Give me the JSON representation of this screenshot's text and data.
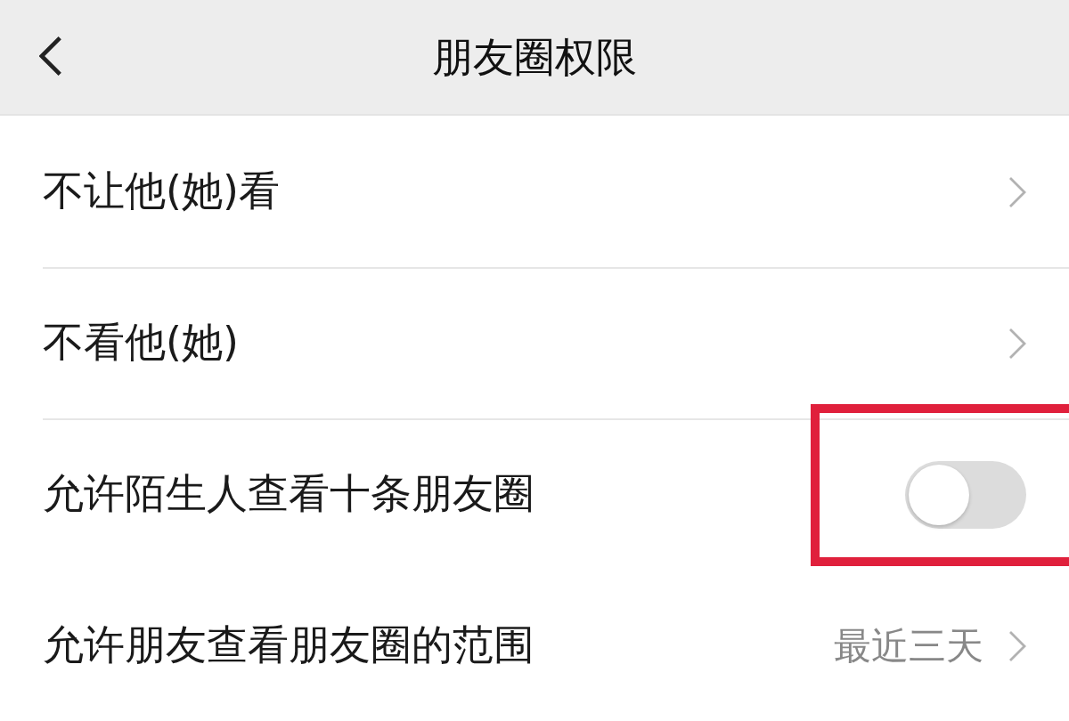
{
  "header": {
    "title": "朋友圈权限"
  },
  "rows": [
    {
      "kind": "link",
      "label": "不让他(她)看"
    },
    {
      "kind": "link",
      "label": "不看他(她)"
    },
    {
      "kind": "toggle",
      "label": "允许陌生人查看十条朋友圈",
      "on": false,
      "highlighted": true
    },
    {
      "kind": "link",
      "label": "允许朋友查看朋友圈的范围",
      "value": "最近三天"
    }
  ]
}
